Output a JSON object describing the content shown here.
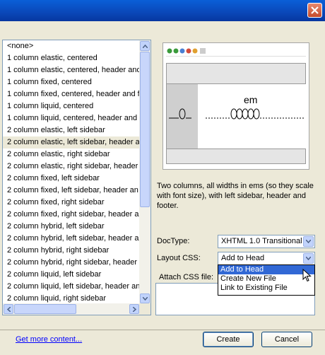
{
  "layouts": [
    "<none>",
    "1 column elastic, centered",
    "1 column elastic, centered, header and",
    "1 column fixed, centered",
    "1 column fixed, centered, header and f",
    "1 column liquid, centered",
    "1 column liquid, centered, header and f",
    "2 column elastic, left sidebar",
    "2 column elastic, left sidebar, header a",
    "2 column elastic, right sidebar",
    "2 column elastic, right sidebar, header",
    "2 column fixed, left sidebar",
    "2 column fixed, left sidebar, header an",
    "2 column fixed, right sidebar",
    "2 column fixed, right sidebar, header a",
    "2 column hybrid, left sidebar",
    "2 column hybrid, left sidebar, header a",
    "2 column hybrid, right sidebar",
    "2 column hybrid, right sidebar, header",
    "2 column liquid, left sidebar",
    "2 column liquid, left sidebar, header an",
    "2 column liquid, right sidebar"
  ],
  "selected_index": 8,
  "preview": {
    "em_label": "em"
  },
  "description": "Two columns, all widths in ems (so they scale with font size), with left sidebar, header and footer.",
  "doctype": {
    "label": "DocType:",
    "value": "XHTML 1.0 Transitional"
  },
  "layout_css": {
    "label": "Layout CSS:",
    "value": "Add to Head",
    "options": [
      "Add to Head",
      "Create New File",
      "Link to Existing File"
    ],
    "highlighted": 0
  },
  "attach_css": {
    "label": "Attach CSS file:"
  },
  "footer": {
    "link": "Get more content...",
    "create": "Create",
    "cancel": "Cancel"
  },
  "colors": {
    "titlebar": "#0a47b8",
    "close": "#c44a2a",
    "highlight": "#3168d5",
    "link": "#0000ff"
  }
}
